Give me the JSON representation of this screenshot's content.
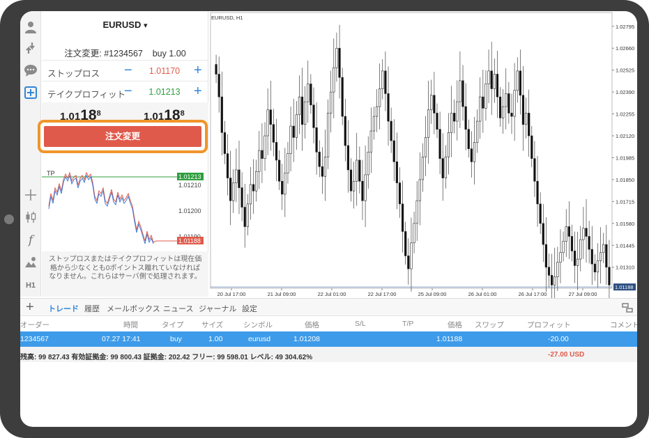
{
  "toolbar": {
    "icons": [
      "user-icon",
      "transfer-icon",
      "chat-icon",
      "new-order-icon",
      "crosshair-icon",
      "candles-icon",
      "function-icon",
      "objects-icon",
      "timeframe-icon"
    ],
    "timeframe_label": "H1",
    "function_label": "f",
    "crosshair_label": "+"
  },
  "order_panel": {
    "symbol": "EURUSD",
    "symbol_arrow": "▾",
    "title": "注文変更: #1234567    buy 1.00",
    "stop_loss": {
      "label": "ストップロス",
      "value": "1.01170",
      "minus": "−",
      "plus": "+"
    },
    "take_profit": {
      "label": "テイクプロフィット",
      "value": "1.01213",
      "minus": "−",
      "plus": "+"
    },
    "bid": {
      "prefix": "1.01",
      "big": "18",
      "sup": "8"
    },
    "ask": {
      "prefix": "1.01",
      "big": "18",
      "sup": "8"
    },
    "modify_button": "注文変更",
    "notice": "ストップロスまたはテイクプロフィットは現在価格から少なくとも0ポイントス離れていなければなりません。これらはサーバ側で処理されます。"
  },
  "mini_chart": {
    "tp_label": "TP",
    "tp_price": "1.01213",
    "current_price": "1.01188",
    "ticks": [
      "1.01210",
      "1.01200",
      "1.01190"
    ],
    "tp_color": "#2e9e3e",
    "current_color": "#e05a4b"
  },
  "chart_data": {
    "type": "candlestick",
    "title": "EURUSD, H1",
    "y_ticks": [
      1.02795,
      1.0266,
      1.02525,
      1.0239,
      1.02255,
      1.0212,
      1.01985,
      1.0185,
      1.01715,
      1.0158,
      1.01445,
      1.0131
    ],
    "y_tick_labels": [
      "1.02795",
      "1.02660",
      "1.02525",
      "1.02390",
      "1.02255",
      "1.02120",
      "1.01985",
      "1.01850",
      "1.01715",
      "1.01580",
      "1.01445",
      "1.01310"
    ],
    "x_labels": [
      "20 Jul 17:00",
      "21 Jul 09:00",
      "22 Jul 01:00",
      "22 Jul 17:00",
      "25 Jul 09:00",
      "26 Jul 01:00",
      "26 Jul 17:00",
      "27 Jul 09:00"
    ],
    "ylim": [
      1.0118,
      1.0288
    ],
    "current_price": 1.01188,
    "current_label": "1.01188",
    "closes": [
      1.025,
      1.0236,
      1.0214,
      1.0201,
      1.0186,
      1.0172,
      1.0183,
      1.0191,
      1.018,
      1.0168,
      1.0156,
      1.017,
      1.0182,
      1.0178,
      1.019,
      1.0203,
      1.0198,
      1.0212,
      1.0228,
      1.0219,
      1.0208,
      1.0197,
      1.0184,
      1.0176,
      1.0189,
      1.0201,
      1.0218,
      1.0211,
      1.0225,
      1.0236,
      1.0219,
      1.0233,
      1.0244,
      1.0231,
      1.0217,
      1.0202,
      1.0193,
      1.0187,
      1.0199,
      1.0226,
      1.0239,
      1.0254,
      1.0266,
      1.0248,
      1.0224,
      1.0206,
      1.0191,
      1.0178,
      1.0184,
      1.0197,
      1.0184,
      1.0172,
      1.0188,
      1.0202,
      1.0215,
      1.0224,
      1.023,
      1.0241,
      1.0252,
      1.0238,
      1.0221,
      1.0209,
      1.0196,
      1.0183,
      1.017,
      1.0153,
      1.0138,
      1.013,
      1.0146,
      1.0158,
      1.0172,
      1.0185,
      1.0199,
      1.0211,
      1.0228,
      1.0237,
      1.0226,
      1.0216,
      1.0198,
      1.0186,
      1.0199,
      1.0214,
      1.0226,
      1.0221,
      1.0233,
      1.0246,
      1.023,
      1.0216,
      1.0204,
      1.0196,
      1.0208,
      1.0221,
      1.0236,
      1.0229,
      1.0244,
      1.0252,
      1.0241,
      1.025,
      1.0236,
      1.0223,
      1.023,
      1.0238,
      1.0226,
      1.0224,
      1.024,
      1.0252,
      1.0237,
      1.0219,
      1.0226,
      1.0212,
      1.0198,
      1.0184,
      1.017,
      1.0158,
      1.0145,
      1.0131,
      1.0126,
      1.012,
      1.0125,
      1.0134,
      1.014,
      1.0147,
      1.0156,
      1.015,
      1.0141,
      1.0132,
      1.0136,
      1.0148,
      1.0155,
      1.015,
      1.0142,
      1.0133,
      1.0128,
      1.0135,
      1.014,
      1.0145,
      1.0131,
      1.012
    ]
  },
  "bottom_tabs": [
    {
      "label": "トレード",
      "active": true
    },
    {
      "label": "履歴",
      "active": false
    },
    {
      "label": "メールボックス",
      "active": false
    },
    {
      "label": "ニュース",
      "active": false
    },
    {
      "label": "ジャーナル",
      "active": false
    },
    {
      "label": "設定",
      "active": false
    }
  ],
  "table": {
    "headers": {
      "order": "オーダー",
      "time": "時間",
      "type": "タイプ",
      "size": "サイズ",
      "symbol": "シンボル",
      "price": "価格",
      "sl": "S/L",
      "tp": "T/P",
      "price2": "価格",
      "swap": "スワップ",
      "profit": "プロフィット",
      "comment": "コメント"
    },
    "row": {
      "order": "1234567",
      "time": "07.27 17:41",
      "type": "buy",
      "size": "1.00",
      "symbol": "eurusd",
      "price": "1.01208",
      "current": "1.01188",
      "profit": "-20.00"
    },
    "footer": {
      "summary": "残高: 99 827.43 有効証拠金: 99 800.43 証拠金: 202.42 フリー: 99 598.01 レベル: 49 304.62%",
      "pl": "-27.00  USD"
    }
  }
}
